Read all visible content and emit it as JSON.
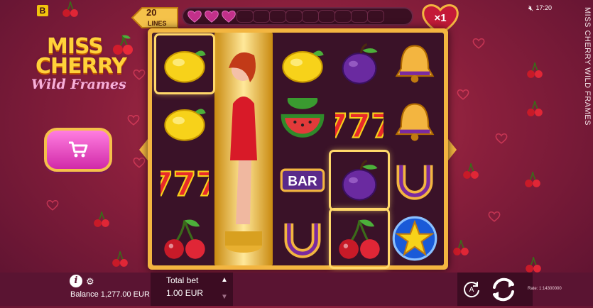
{
  "app": {
    "brand_letter": "B",
    "side_title": "MISS CHERRY WILD FRAMES",
    "clock": "17:20"
  },
  "logo": {
    "line1": "MISS",
    "line2": "CHERRY",
    "line3": "Wild Frames"
  },
  "lines": {
    "count": "20",
    "label": "LINES"
  },
  "meter": {
    "filled": 3,
    "total": 12
  },
  "multiplier": {
    "label": "×1"
  },
  "reels": {
    "columns": [
      [
        "lemon",
        "lemon",
        "seven",
        "cherry"
      ],
      [
        "wild",
        "wild",
        "wild",
        "wild"
      ],
      [
        "lemon",
        "watermelon",
        "bar",
        "horseshoe"
      ],
      [
        "plum",
        "seven",
        "plum",
        "cherry"
      ],
      [
        "bell",
        "bell",
        "horseshoe",
        "star"
      ]
    ],
    "highlighted": [
      "0-0",
      "3-2",
      "3-3"
    ],
    "bar_label": "BAR"
  },
  "bottom": {
    "balance_label": "Balance 1,277.00 EUR",
    "total_bet_label": "Total bet",
    "total_bet_value": "1.00 EUR",
    "bet_up": "▲",
    "bet_down": "▼",
    "auto_label": "A",
    "rate": "Rate: 1:14300000"
  },
  "icons": {
    "mute": "speaker-mute-icon",
    "info": "info-icon",
    "settings": "gear-icon",
    "shop": "cart-icon",
    "spin": "spin-icon",
    "auto": "autoplay-icon"
  },
  "colors": {
    "gold": "#f3b540",
    "heart": "#c2308a",
    "background": "#8a1f3c"
  }
}
